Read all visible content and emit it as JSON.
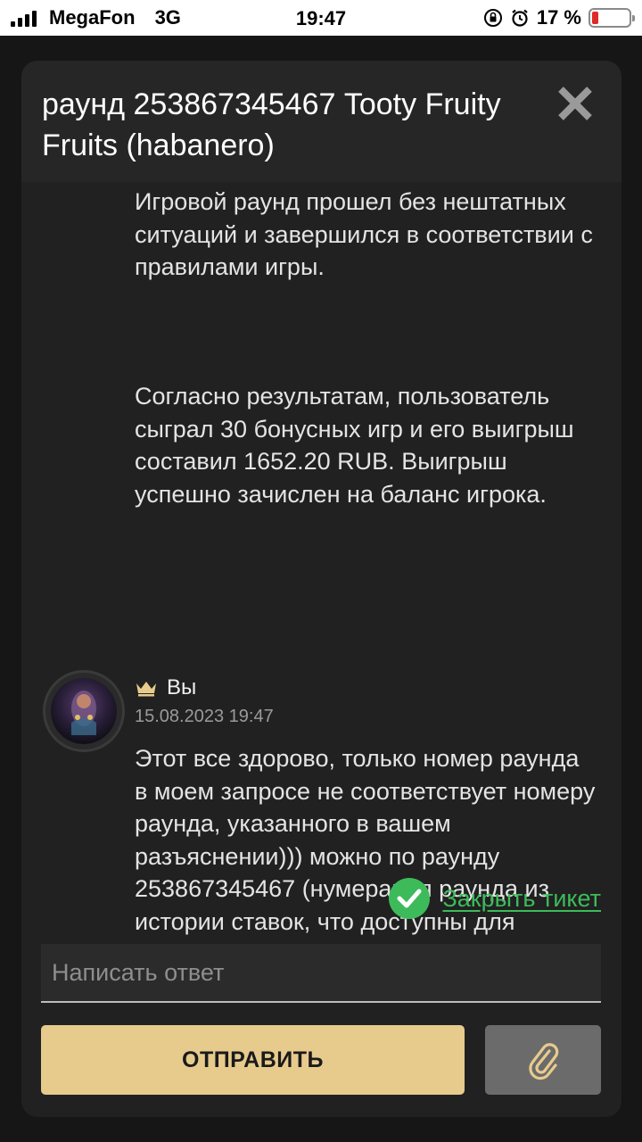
{
  "status_bar": {
    "carrier": "MegaFon",
    "network": "3G",
    "time": "19:47",
    "battery_percent": "17 %",
    "battery_level": 0.17
  },
  "modal": {
    "title": "раунд 253867345467 Tooty Fruity Fruits (habanero)",
    "close_icon": "close-icon"
  },
  "thread": {
    "support_message_paragraph_1": "Игровой раунд прошел без нештатных ситуаций и завершился в соответствии с правилами игры.",
    "support_message_paragraph_2": "Согласно результатам, пользователь сыграл 30 бонусных игр и его выигрыш составил 1652.20 RUB. Выигрыш успешно зачислен на баланс игрока.",
    "user_message": {
      "author": "Вы",
      "date": "15.08.2023 19:47",
      "text": "Этот все здорово, только номер раунда в моем запросе не соответствует номеру раунда, указанного в вашем разъяснении))) можно по раунду 253867345467 (нумерация раунда из истории ставок, что доступны для просмотра в самом слоте). Спасибо"
    }
  },
  "actions": {
    "close_ticket_label": "Закрыть тикет",
    "reply_placeholder": "Написать ответ",
    "send_label": "ОТПРАВИТЬ"
  },
  "colors": {
    "accent_gold": "#e7cb8d",
    "success_green": "#3dbb5a",
    "modal_bg": "#212121"
  }
}
